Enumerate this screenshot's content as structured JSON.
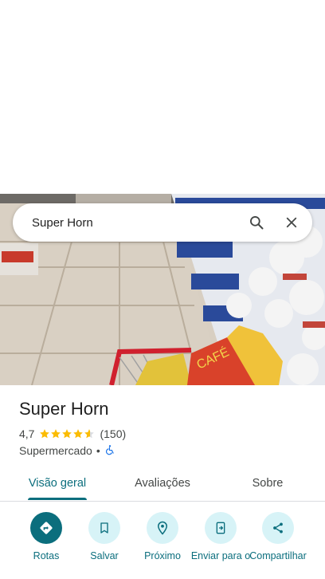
{
  "search": {
    "query": "Super Horn"
  },
  "place": {
    "name": "Super Horn",
    "rating": "4,7",
    "rating_value": 4.7,
    "reviews_count": "(150)",
    "category": "Supermercado",
    "separator": "•"
  },
  "tabs": [
    {
      "label": "Visão geral",
      "active": true
    },
    {
      "label": "Avaliações",
      "active": false
    },
    {
      "label": "Sobre",
      "active": false
    }
  ],
  "actions": [
    {
      "label": "Rotas",
      "icon": "directions-icon"
    },
    {
      "label": "Salvar",
      "icon": "bookmark-icon"
    },
    {
      "label": "Próximo",
      "icon": "nearby-icon"
    },
    {
      "label": "Enviar para o",
      "icon": "send-to-phone-icon"
    },
    {
      "label": "Compartilhar",
      "icon": "share-icon"
    }
  ],
  "colors": {
    "accent": "#0b6e7d",
    "chip_background": "#d7f3f7",
    "star": "#fbbc04",
    "accessible_icon": "#1a73e8"
  }
}
